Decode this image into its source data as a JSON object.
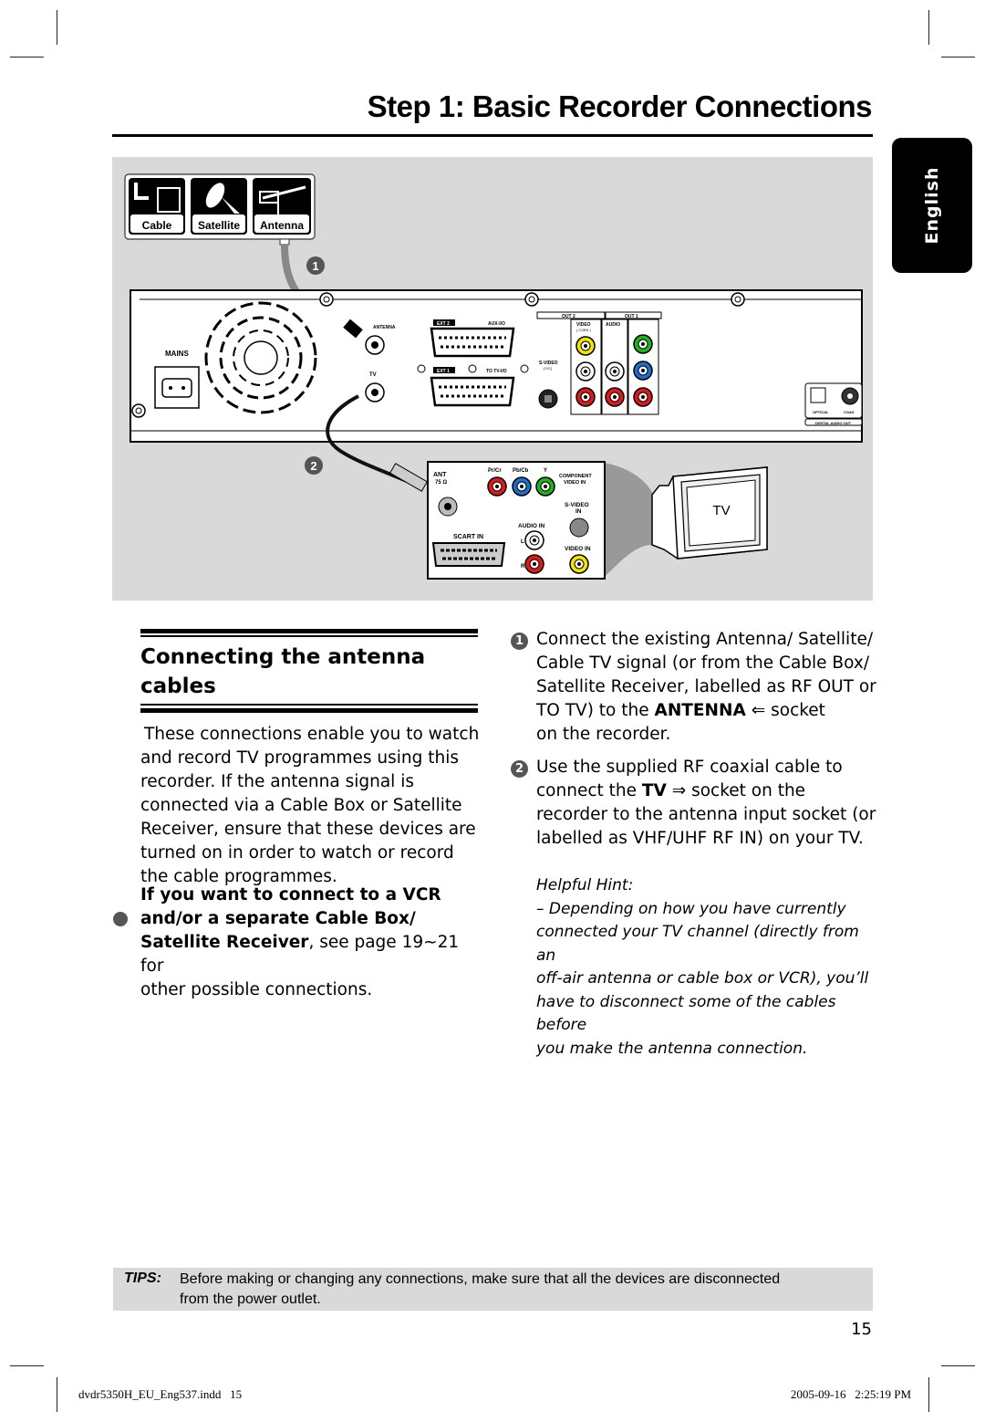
{
  "header": {
    "title": "Step 1: Basic Recorder Connections",
    "language_tab": "English"
  },
  "figure": {
    "source_labels": [
      "Cable",
      "Satellite",
      "Antenna"
    ],
    "step_markers": [
      "1",
      "2"
    ],
    "recorder_labels": {
      "mains": "MAINS",
      "antenna": "ANTENNA",
      "tv": "TV",
      "ext2": "EXT 2",
      "aux": "AUX-I/O",
      "ext1": "EXT 1",
      "to_tv": "TO TV-I/O",
      "svideo": "S-VIDEO",
      "svideo_sub": "(Y/C)",
      "out2": "OUT 2",
      "out1": "OUT 1",
      "video": "VIDEO",
      "cvbs": "( CVBS )",
      "audio": "AUDIO",
      "optical": "OPTICAL",
      "coax": "COAX",
      "digital_audio_out": "DIGITAL AUDIO OUT"
    },
    "tv_panel_labels": {
      "ant": "ANT",
      "ohm": "75 Ω",
      "pr": "Pr/Cr",
      "pb": "Pb/Cb",
      "y": "Y",
      "component": "COMPONENT",
      "video_in_c": "VIDEO IN",
      "svideo_in": "S-VIDEO",
      "in": "IN",
      "audio_in": "AUDIO IN",
      "scart_in": "SCART IN",
      "l": "L",
      "r": "R",
      "video_in": "VIDEO IN"
    },
    "tv_label": "TV",
    "colors": {
      "yellow": "#f2e600",
      "green": "#1db31d",
      "blue": "#1a6fd0",
      "red": "#e01919",
      "white": "#ffffff",
      "panel_bg": "#d9d9d9"
    }
  },
  "section": {
    "title_line1": "Connecting the antenna",
    "title_line2": "cables",
    "intro": [
      "These connections enable you to watch",
      "and record TV programmes using this",
      "recorder. If the antenna signal is",
      "connected via a Cable Box or Satellite",
      "Receiver, ensure that these devices are",
      "turned on in order to watch or record",
      "the cable programmes."
    ],
    "bullet": {
      "bold1": "If you want to connect to a VCR",
      "bold2": "and/or a separate Cable Box/",
      "bold3": "Satellite Receiver",
      "rest3": ", see page 19~21 for",
      "line4": "other possible connections."
    }
  },
  "steps": [
    {
      "num": "1",
      "lines": [
        "Connect the existing Antenna/ Satellite/",
        "Cable TV signal (or from the Cable Box/",
        "Satellite Receiver, labelled as RF OUT or"
      ],
      "line4_pre": "TO TV) to the ",
      "line4_bold": "ANTENNA",
      "line4_post": " socket",
      "line5": "on the recorder."
    },
    {
      "num": "2",
      "line1": "Use the supplied RF coaxial cable to",
      "line2_pre": "connect the ",
      "line2_bold": "TV",
      "line2_post": " socket on the",
      "line3": "recorder to the antenna input socket (or",
      "line4": "labelled as VHF/UHF RF IN) on your TV."
    }
  ],
  "hint": {
    "title": "Helpful Hint:",
    "lines": [
      "– Depending on how you have currently",
      "connected your TV channel (directly from an",
      "off-air antenna or cable box or VCR), you’ll",
      "have to disconnect some of the cables before",
      "you make the antenna connection."
    ]
  },
  "tips": {
    "label": "TIPS:",
    "text_line1": "Before making or changing any connections, make sure that all the devices are disconnected",
    "text_line2": "from the power outlet."
  },
  "page_number": "15",
  "footer": {
    "left": "dvdr5350H_EU_Eng537.indd   15",
    "right": "2005-09-16   2:25:19 PM"
  }
}
